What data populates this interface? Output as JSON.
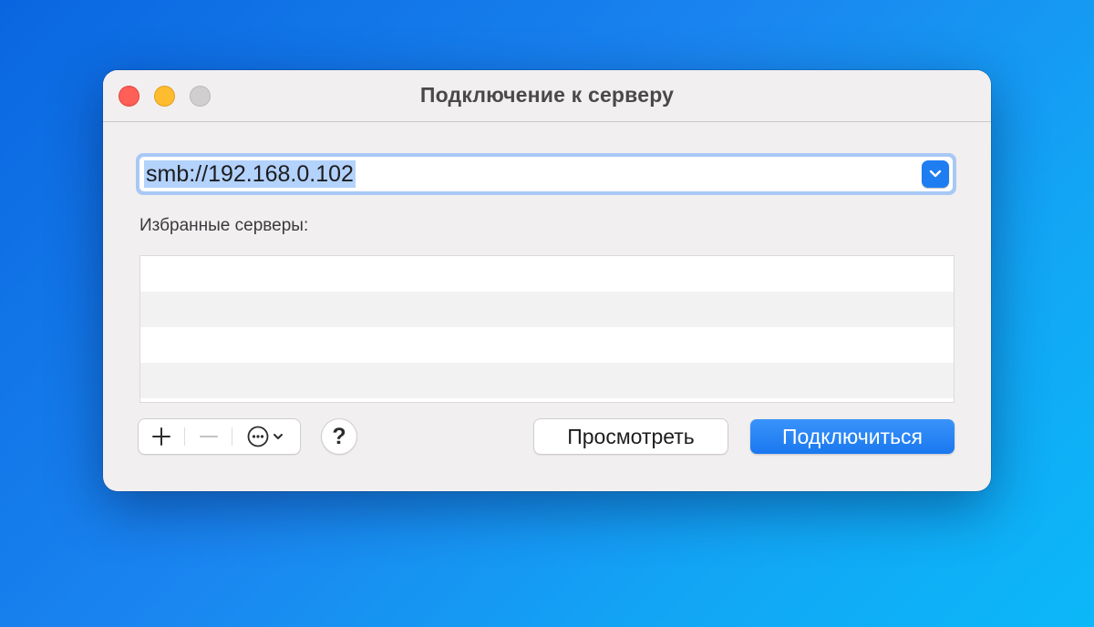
{
  "window": {
    "title": "Подключение к серверу"
  },
  "address": {
    "value": "smb://192.168.0.102"
  },
  "favorites": {
    "label": "Избранные серверы:",
    "items": []
  },
  "buttons": {
    "help_label": "?",
    "browse_label": "Просмотреть",
    "connect_label": "Подключиться"
  },
  "icons": {
    "add": "plus-icon",
    "remove": "minus-icon",
    "more": "ellipsis-circle-icon",
    "dropdown": "chevron-down-icon"
  },
  "colors": {
    "accent": "#1f7df2",
    "close": "#fe5f57",
    "minimize": "#febc2e",
    "maximize_disabled": "#d0cecf",
    "selection": "#b3d2fc"
  }
}
